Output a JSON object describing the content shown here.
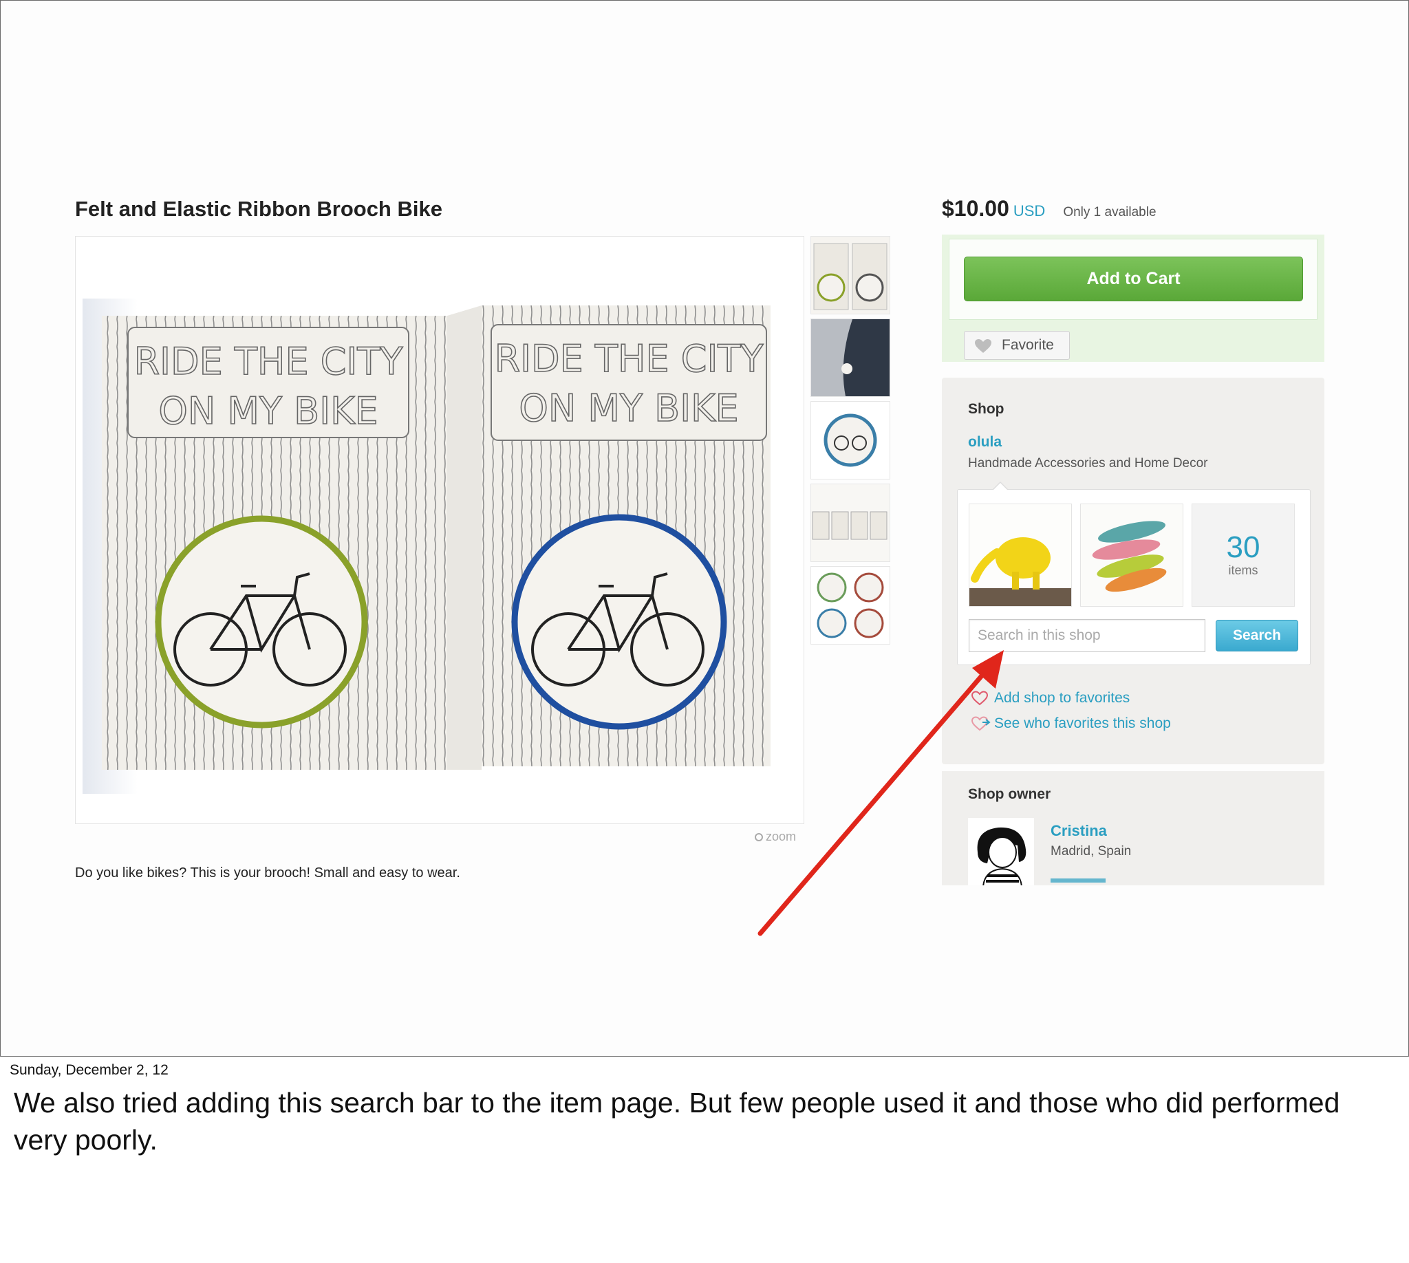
{
  "listing": {
    "title": "Felt and Elastic Ribbon Brooch Bike",
    "description": "Do you like bikes? This is your brooch! Small and easy to wear.",
    "zoom_label": "zoom",
    "image_text_line1": "RIDE THE CITY",
    "image_text_line2": "ON MY BIKE"
  },
  "purchase": {
    "price": "$10.00",
    "currency": "USD",
    "availability": "Only 1 available",
    "add_to_cart_label": "Add to Cart",
    "favorite_label": "Favorite"
  },
  "shop": {
    "section_label": "Shop",
    "name": "olula",
    "tagline": "Handmade Accessories and Home Decor",
    "item_count": "30",
    "item_count_label": "items",
    "search_placeholder": "Search in this shop",
    "search_button_label": "Search",
    "add_favorites_label": "Add shop to favorites",
    "see_favorites_label": "See who favorites this shop"
  },
  "owner": {
    "section_label": "Shop owner",
    "name": "Cristina",
    "location": "Madrid, Spain"
  },
  "slide": {
    "date": "Sunday, December 2, 12",
    "note": "We also tried adding this search bar to the item page. But few people used it and those who did performed very poorly."
  },
  "colors": {
    "link_blue": "#2a9ec1",
    "cart_green": "#5aa838",
    "search_blue": "#3aa9cf",
    "annotation_red": "#e0261b"
  }
}
